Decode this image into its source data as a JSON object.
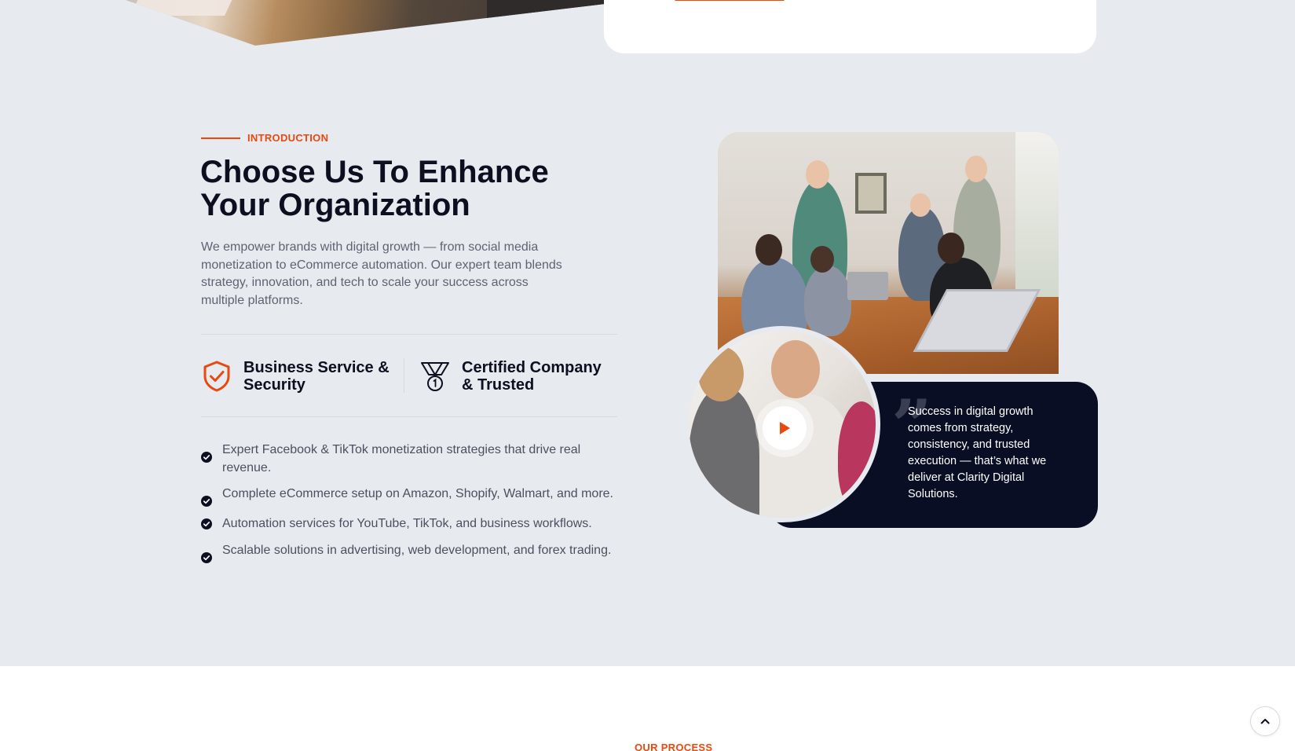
{
  "about": {
    "eyebrow": "INTRODUCTION",
    "heading": "Choose Us To Enhance Your Organization",
    "lead": "We empower brands with digital growth — from social media monetization to eCommerce automation. Our expert team blends strategy, innovation, and tech to scale your success across multiple platforms.",
    "features": [
      {
        "label": "Business Service & Security",
        "icon": "shield-check-icon"
      },
      {
        "label": "Certified Company & Trusted",
        "icon": "medal-icon"
      }
    ],
    "checklist": [
      "Expert Facebook & TikTok monetization strategies that drive real revenue.",
      "Complete eCommerce setup on Amazon, Shopify, Walmart, and more.",
      "Automation services for YouTube, TikTok, and business workflows.",
      "Scalable solutions in advertising, web development, and forex trading."
    ],
    "quote": "Success in digital growth comes from strategy, consistency, and trusted execution — that’s what we deliver at Clarity Digital Solutions.",
    "video_button": "play-icon"
  },
  "next_section": {
    "eyebrow": "OUR PROCESS"
  },
  "colors": {
    "accent": "#e8490f",
    "dark": "#0a0e24",
    "background": "#e7eaee"
  }
}
